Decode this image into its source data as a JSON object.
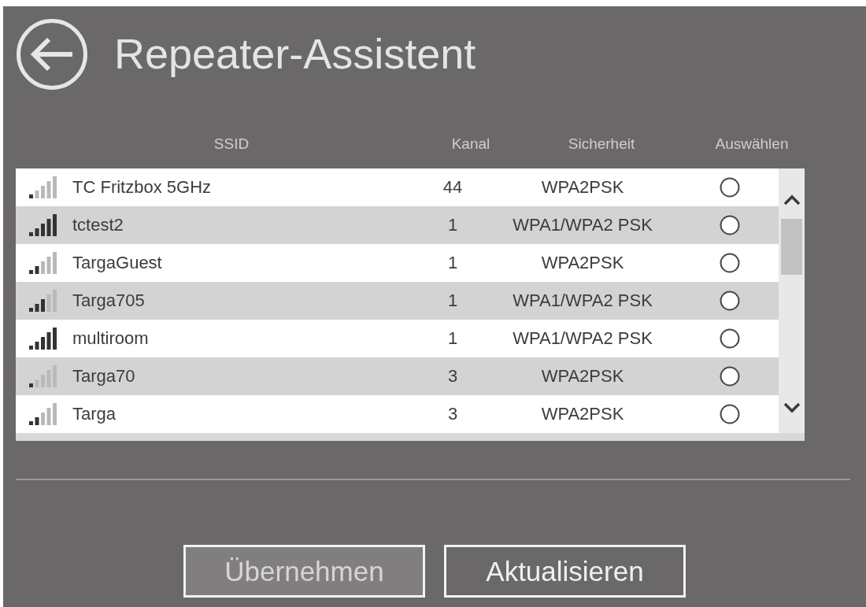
{
  "header": {
    "title": "Repeater-Assistent"
  },
  "table": {
    "columns": [
      "SSID",
      "Kanal",
      "Sicherheit",
      "Auswählen"
    ],
    "rows": [
      {
        "kind": "weak",
        "ssid": "TC Fritzbox 5GHz",
        "channel": "44",
        "security": "WPA2PSK",
        "selected": false
      },
      {
        "kind": "full",
        "ssid": "tctest2",
        "channel": "1",
        "security": "WPA1/WPA2 PSK",
        "selected": false
      },
      {
        "kind": "fair",
        "ssid": "TargaGuest",
        "channel": "1",
        "security": "WPA2PSK",
        "selected": false
      },
      {
        "kind": "good",
        "ssid": "Targa705",
        "channel": "1",
        "security": "WPA1/WPA2 PSK",
        "selected": false
      },
      {
        "kind": "full",
        "ssid": "multiroom",
        "channel": "1",
        "security": "WPA1/WPA2 PSK",
        "selected": false
      },
      {
        "kind": "weak",
        "ssid": "Targa70",
        "channel": "3",
        "security": "WPA2PSK",
        "selected": false
      },
      {
        "kind": "fair",
        "ssid": "Targa",
        "channel": "3",
        "security": "WPA2PSK",
        "selected": false
      }
    ]
  },
  "buttons": [
    {
      "label": "Übernehmen",
      "disabled": true
    },
    {
      "label": "Aktualisieren",
      "disabled": false
    }
  ]
}
